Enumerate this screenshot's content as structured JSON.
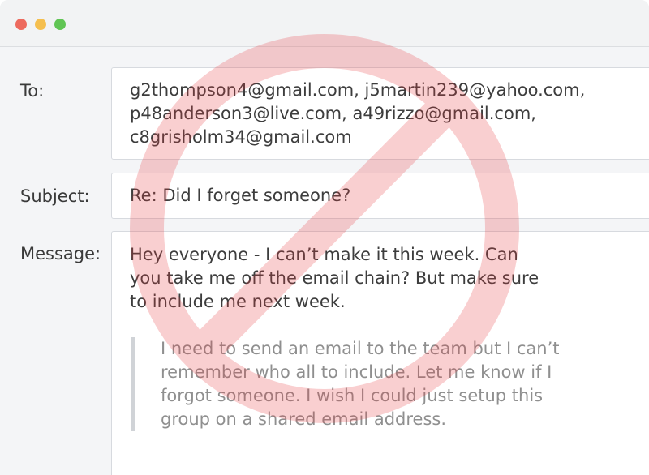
{
  "window": {
    "controls": [
      {
        "name": "close",
        "color": "#ed6a5e"
      },
      {
        "name": "minimize",
        "color": "#f5bf4f"
      },
      {
        "name": "maximize",
        "color": "#61c554"
      }
    ]
  },
  "email": {
    "to_label": "To:",
    "to_value": "g2thompson4@gmail.com, j5martin239@yahoo.com,\np48anderson3@live.com, a49rizzo@gmail.com,\nc8grisholm34@gmail.com",
    "subject_label": "Subject:",
    "subject_value": "Re: Did I forget someone?",
    "message_label": "Message:",
    "message_body": "Hey everyone - I can’t make it this week. Can\nyou take me off the email chain? But make sure\nto include me next week.",
    "quoted_message": "I need to send an email to the team but I can’t\nremember who all to include. Let me know if I\nforgot someone. I wish I could just setup this\ngroup on a shared email address."
  },
  "overlay": {
    "icon": "prohibited-icon",
    "color": "#e8393f"
  }
}
